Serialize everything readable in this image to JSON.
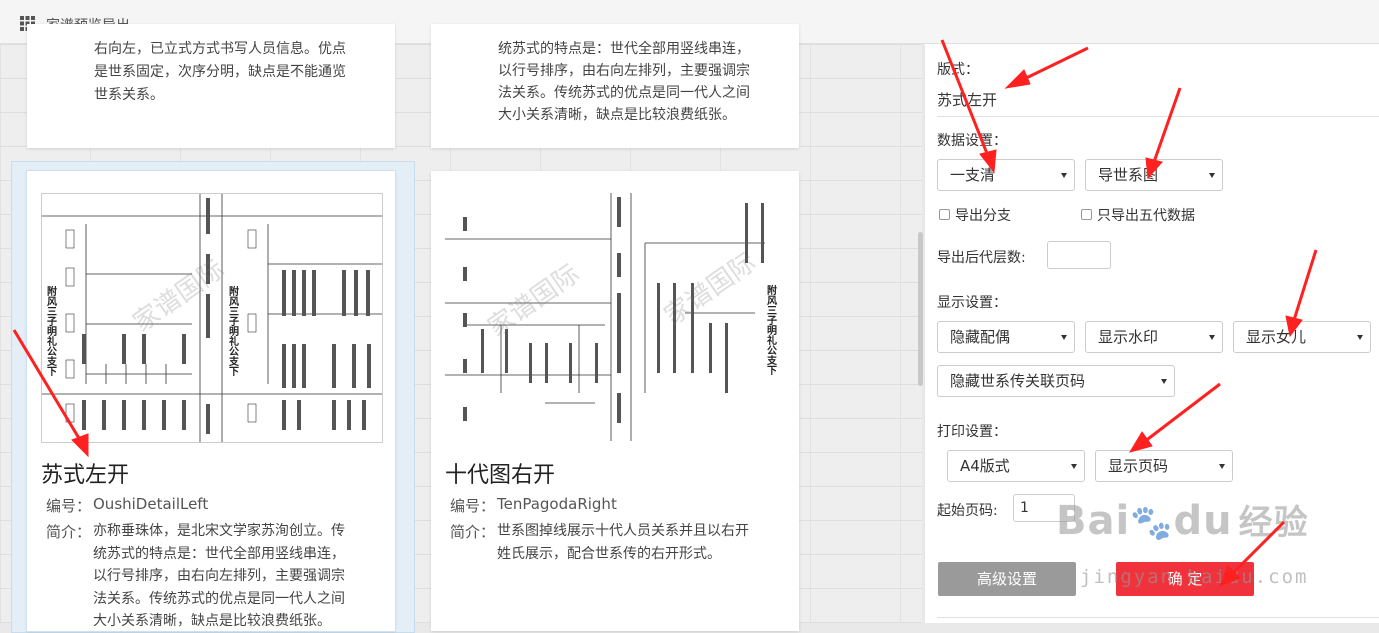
{
  "header": {
    "title": "家谱预览导出",
    "icon": "grid-icon"
  },
  "top_cards": [
    {
      "lines": [
        "右向左，已立式方式书写人员信息。优点",
        "是世系固定，次序分明，缺点是不能通览",
        "世系关系。"
      ]
    },
    {
      "lines": [
        "统苏式的特点是：世代全部用竖线串连，",
        "以行号排序，由右向左排列，主要强调宗",
        "法关系。传统苏式的优点是同一代人之间",
        "大小关系清晰，缺点是比较浪费纸张。"
      ]
    }
  ],
  "templates": [
    {
      "title": "苏式左开",
      "code_label": "编号：",
      "code": "OushiDetailLeft",
      "intro_label": "简介：",
      "intro_lines": [
        "亦称垂珠体，是北宋文学家苏洵创立。传",
        "统苏式的特点是：世代全部用竖线串连，",
        "以行号排序，由右向左排列，主要强调宗",
        "法关系。传统苏式的优点是同一代人之间",
        "大小关系清晰，缺点是比较浪费纸张。"
      ],
      "preview_watermark": "家谱国际",
      "preview_side_text": "附风三子明礼公支下"
    },
    {
      "title": "十代图右开",
      "code_label": "编号：",
      "code": "TenPagodaRight",
      "intro_label": "简介：",
      "intro_lines": [
        "世系图掉线展示十代人员关系并且以右开",
        "姓氏展示，配合世系传的右开形式。"
      ],
      "preview_watermark": "家谱国际",
      "preview_side_text": "附风三子明礼公支下"
    }
  ],
  "panel": {
    "layout_label": "版式：",
    "layout_value": "苏式左开",
    "data_settings_label": "数据设置：",
    "data_select_1": "一支清",
    "data_select_2": "导世系图",
    "checkbox_1": "导出分支",
    "checkbox_2": "只导出五代数据",
    "generations_label": "导出后代层数:",
    "generations_value": "",
    "display_settings_label": "显示设置：",
    "display_select_1": "隐藏配偶",
    "display_select_2": "显示水印",
    "display_select_3": "显示女儿",
    "display_select_4": "隐藏世系传关联页码",
    "print_settings_label": "打印设置：",
    "print_select_1": "A4版式",
    "print_select_2": "显示页码",
    "start_page_label": "起始页码:",
    "start_page_value": "1",
    "advanced_button": "高级设置",
    "confirm_button": "确    定"
  },
  "overlay": {
    "watermark_logo": "Bai",
    "watermark_logo2": "du",
    "watermark_cn": "经验",
    "watermark_url": "jingyan.baidu.com",
    "arrow_color": "#ff2020"
  }
}
